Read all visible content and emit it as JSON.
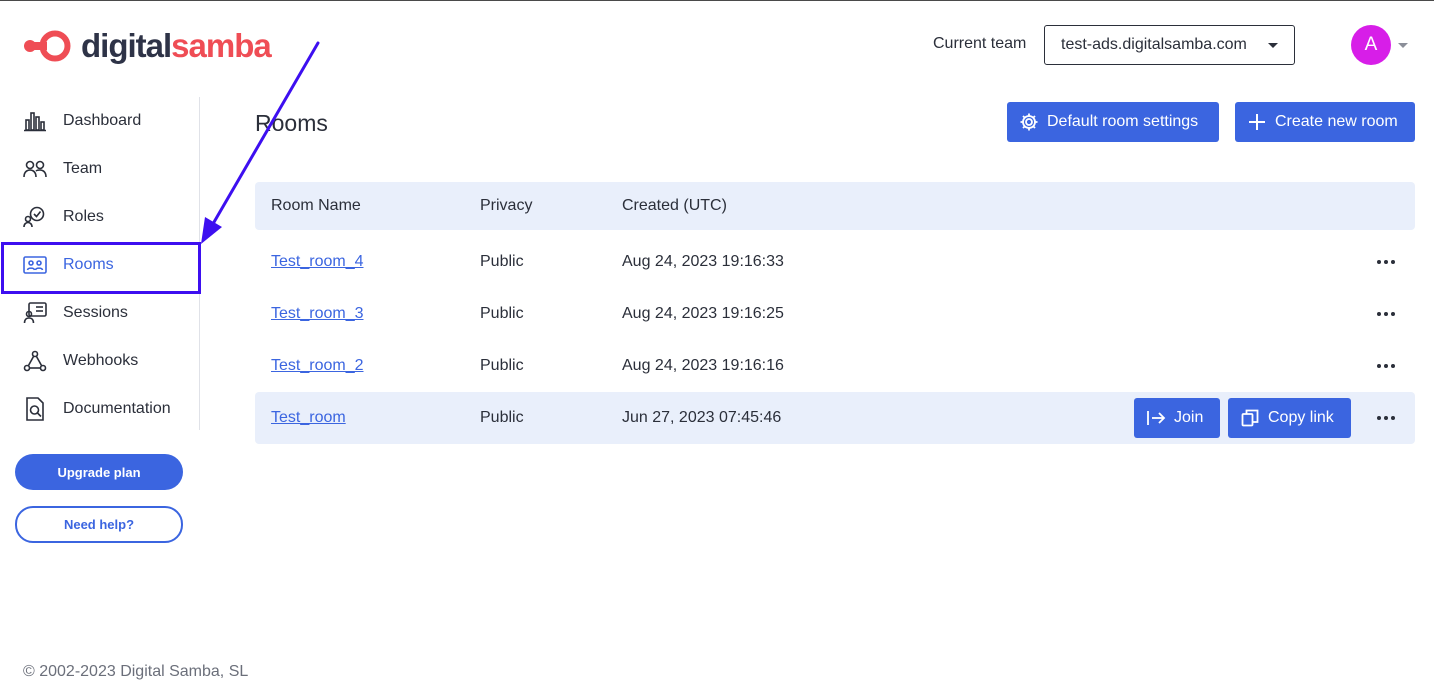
{
  "brand": {
    "logo_part1": "digital",
    "logo_part2": "samba",
    "accent": "#ef4d55",
    "dark": "#2e3347"
  },
  "header": {
    "team_label": "Current team",
    "team_value": "test-ads.digitalsamba.com",
    "avatar_initial": "A",
    "avatar_color": "#d71ee8"
  },
  "sidebar": {
    "items": [
      {
        "label": "Dashboard",
        "icon": "bar-chart-icon"
      },
      {
        "label": "Team",
        "icon": "team-icon"
      },
      {
        "label": "Roles",
        "icon": "roles-icon"
      },
      {
        "label": "Rooms",
        "icon": "rooms-icon",
        "active": true
      },
      {
        "label": "Sessions",
        "icon": "sessions-icon"
      },
      {
        "label": "Webhooks",
        "icon": "webhooks-icon"
      },
      {
        "label": "Documentation",
        "icon": "documentation-icon"
      }
    ],
    "upgrade_label": "Upgrade plan",
    "help_label": "Need help?"
  },
  "main": {
    "title": "Rooms",
    "default_settings_label": "Default room settings",
    "create_label": "Create new room",
    "table": {
      "headers": [
        "Room Name",
        "Privacy",
        "Created (UTC)"
      ],
      "rows": [
        {
          "name": "Test_room_4",
          "privacy": "Public",
          "created": "Aug 24, 2023 19:16:33"
        },
        {
          "name": "Test_room_3",
          "privacy": "Public",
          "created": "Aug 24, 2023 19:16:25"
        },
        {
          "name": "Test_room_2",
          "privacy": "Public",
          "created": "Aug 24, 2023 19:16:16"
        },
        {
          "name": "Test_room",
          "privacy": "Public",
          "created": "Jun 27, 2023 07:45:46"
        }
      ],
      "join_label": "Join",
      "copy_label": "Copy link"
    }
  },
  "footer": {
    "copyright": "© 2002-2023 Digital Samba, SL"
  },
  "colors": {
    "primary": "#3b65e0",
    "header_row_bg": "#e9effb",
    "annotation": "#3d0ff0"
  }
}
